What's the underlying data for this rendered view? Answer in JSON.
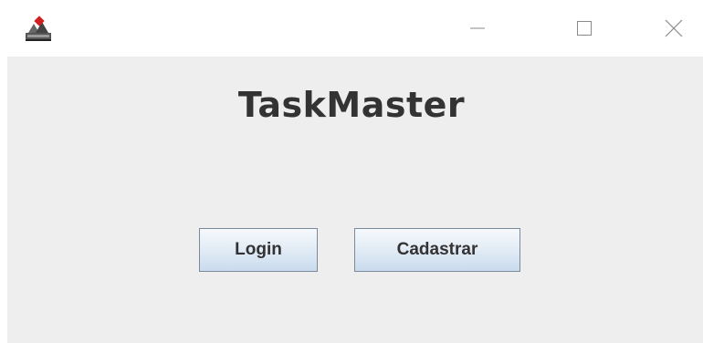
{
  "window": {
    "icon": "java-app-icon",
    "controls": {
      "minimize_icon": "minimize-icon",
      "maximize_icon": "maximize-icon",
      "close_icon": "close-icon"
    }
  },
  "main": {
    "title": "TaskMaster",
    "buttons": {
      "login_label": "Login",
      "register_label": "Cadastrar"
    }
  },
  "colors": {
    "content_background": "#eeeeee",
    "title_text": "#333333",
    "button_border": "#7a8a99"
  }
}
